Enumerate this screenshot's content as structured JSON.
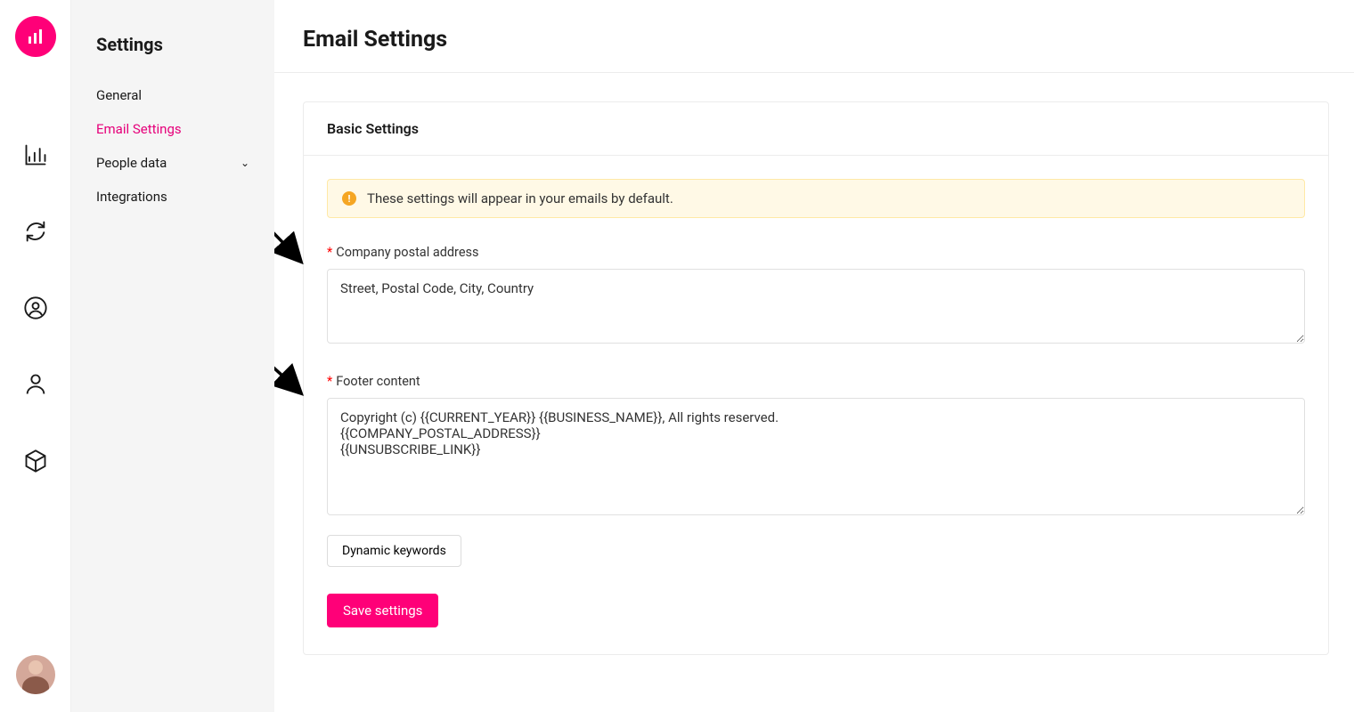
{
  "sidebar": {
    "title": "Settings",
    "items": [
      {
        "label": "General",
        "active": false
      },
      {
        "label": "Email Settings",
        "active": true
      },
      {
        "label": "People data",
        "active": false,
        "expandable": true
      },
      {
        "label": "Integrations",
        "active": false
      }
    ]
  },
  "page": {
    "title": "Email Settings"
  },
  "card": {
    "header": "Basic Settings",
    "alert": "These settings will appear in your emails by default.",
    "fields": {
      "address": {
        "label": "Company postal address",
        "value": "Street, Postal Code, City, Country"
      },
      "footer": {
        "label": "Footer content",
        "value": "Copyright (c) {{CURRENT_YEAR}} {{BUSINESS_NAME}}, All rights reserved.\n{{COMPANY_POSTAL_ADDRESS}}\n{{UNSUBSCRIBE_LINK}}"
      }
    },
    "dynamic_keywords_label": "Dynamic keywords",
    "save_label": "Save settings"
  },
  "colors": {
    "brand": "#ff0078",
    "alert_bg": "#fff9e6",
    "alert_icon": "#f5a623"
  }
}
